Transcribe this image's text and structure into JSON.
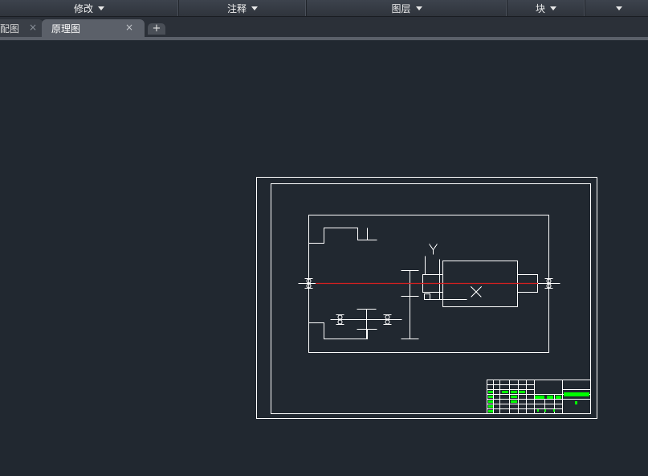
{
  "ribbon": {
    "panels": [
      {
        "label": "修改"
      },
      {
        "label": "注释"
      },
      {
        "label": "图层"
      },
      {
        "label": "块"
      }
    ]
  },
  "tabs": [
    {
      "label": "配图",
      "close": "×"
    },
    {
      "label": "原理图",
      "close": "×"
    }
  ],
  "new_tab": "+",
  "drawing": {
    "axis_label": "Y",
    "colors": {
      "background": "#212830",
      "lines": "#ffffff",
      "center_line": "#ff2020",
      "title_block_fill": "#00ff00"
    }
  }
}
